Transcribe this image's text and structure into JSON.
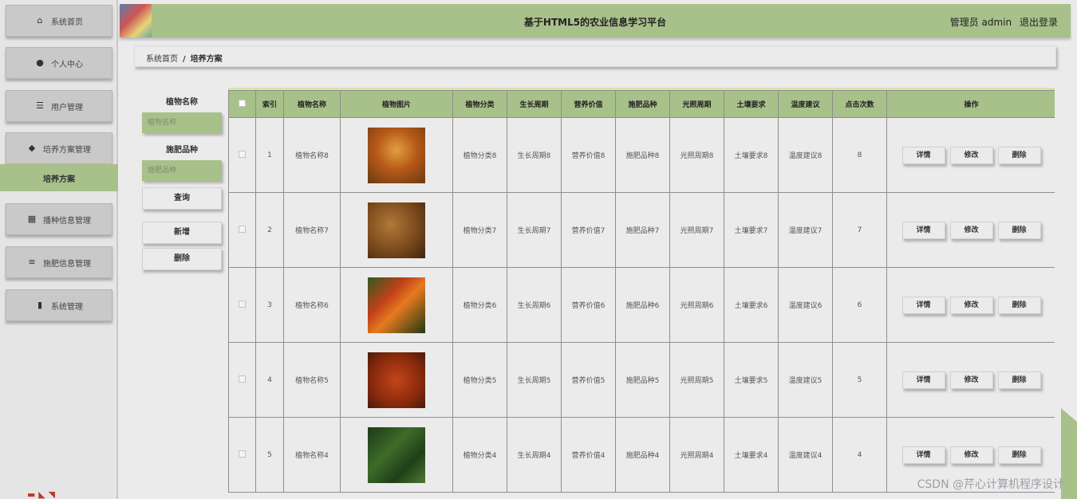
{
  "sidebar": {
    "items": [
      {
        "label": "系统首页",
        "icon": "home-icon"
      },
      {
        "label": "个人中心",
        "icon": "user-icon"
      },
      {
        "label": "用户管理",
        "icon": "sliders-icon"
      },
      {
        "label": "培养方案管理",
        "icon": "pin-icon"
      },
      {
        "label": "播种信息管理",
        "icon": "grid-icon"
      },
      {
        "label": "施肥信息管理",
        "icon": "list-icon"
      },
      {
        "label": "系统管理",
        "icon": "bar-chart-icon"
      }
    ],
    "active_sub": "培养方案"
  },
  "header": {
    "title": "基于HTML5的农业信息学习平台",
    "user": "管理员 admin",
    "logout": "退出登录"
  },
  "breadcrumb": {
    "home": "系统首页",
    "sep": "/",
    "current": "培养方案"
  },
  "search": {
    "name_label": "植物名称",
    "name_placeholder": "植物名称",
    "fert_label": "施肥品种",
    "fert_placeholder": "施肥品种",
    "query_btn": "查询",
    "add_btn": "新增",
    "delete_btn": "删除"
  },
  "table": {
    "headers": [
      "索引",
      "植物名称",
      "植物图片",
      "植物分类",
      "生长周期",
      "营养价值",
      "施肥品种",
      "光照周期",
      "土壤要求",
      "温度建议",
      "点击次数",
      "操作"
    ],
    "rows": [
      {
        "idx": "1",
        "name": "植物名称8",
        "category": "植物分类8",
        "growth": "生长周期8",
        "nutrition": "营养价值8",
        "fert": "施肥品种8",
        "light": "光照周期8",
        "soil": "土壤要求8",
        "temp": "温度建议8",
        "clicks": "8",
        "img": "grain"
      },
      {
        "idx": "2",
        "name": "植物名称7",
        "category": "植物分类7",
        "growth": "生长周期7",
        "nutrition": "营养价值7",
        "fert": "施肥品种7",
        "light": "光照周期7",
        "soil": "土壤要求7",
        "temp": "温度建议7",
        "clicks": "7",
        "img": "potato"
      },
      {
        "idx": "3",
        "name": "植物名称6",
        "category": "植物分类6",
        "growth": "生长周期6",
        "nutrition": "营养价值6",
        "fert": "施肥品种6",
        "light": "光照周期6",
        "soil": "土壤要求6",
        "temp": "温度建议6",
        "clicks": "6",
        "img": "vegetables"
      },
      {
        "idx": "4",
        "name": "植物名称5",
        "category": "植物分类5",
        "growth": "生长周期5",
        "nutrition": "营养价值5",
        "fert": "施肥品种5",
        "light": "光照周期5",
        "soil": "土壤要求5",
        "temp": "温度建议5",
        "clicks": "5",
        "img": "spice"
      },
      {
        "idx": "5",
        "name": "植物名称4",
        "category": "植物分类4",
        "growth": "生长周期4",
        "nutrition": "营养价值4",
        "fert": "施肥品种4",
        "light": "光照周期4",
        "soil": "土壤要求4",
        "temp": "温度建议4",
        "clicks": "4",
        "img": "greens"
      }
    ],
    "ops": {
      "detail": "详情",
      "edit": "修改",
      "delete": "删除"
    }
  },
  "watermark": "CSDN @芹心计算机程序设计",
  "colors": {
    "accent": "#a8c08a",
    "background": "#ecebec"
  }
}
